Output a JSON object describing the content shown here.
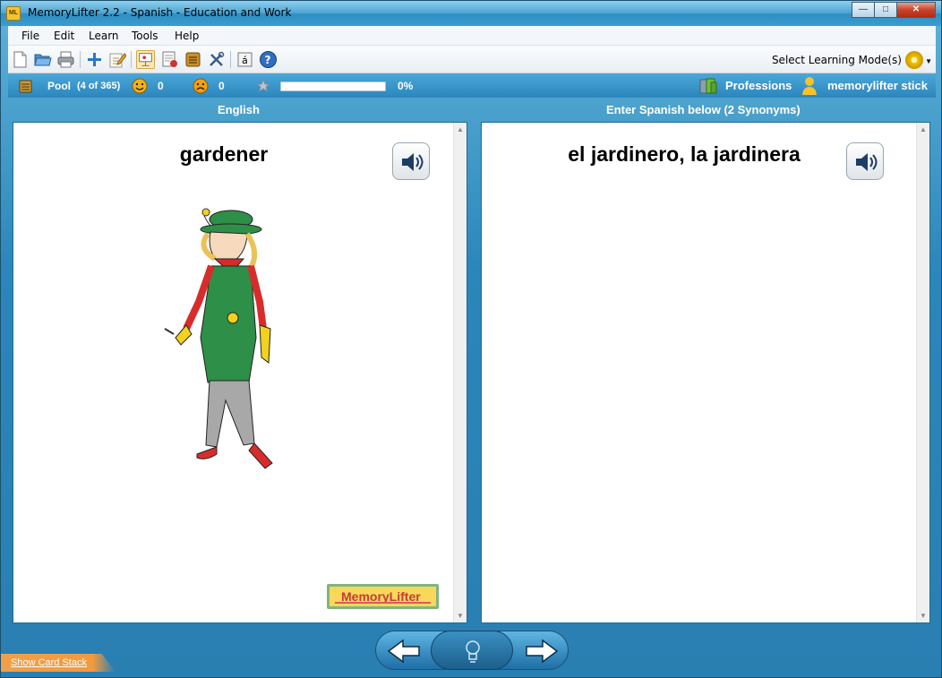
{
  "window": {
    "title": "MemoryLifter 2.2 - Spanish - Education and Work",
    "icon_text": "ML"
  },
  "menu": {
    "items": [
      "File",
      "Edit",
      "Learn",
      "Tools",
      "Help"
    ]
  },
  "toolbar": {
    "icons": [
      "new-file-icon",
      "open-folder-icon",
      "print-icon",
      "add-card-icon",
      "edit-notes-icon",
      "presentation-icon",
      "card-view-icon",
      "chapter-icon",
      "settings-tools-icon",
      "special-char-icon",
      "help-icon"
    ],
    "mode_label": "Select Learning Mode(s)"
  },
  "status": {
    "pool_label": "Pool",
    "pool_count": "(4 of 365)",
    "correct_count": "0",
    "wrong_count": "0",
    "progress_percent": 0,
    "progress_text": "0%",
    "category": "Professions",
    "user": "memorylifter stick"
  },
  "columns": {
    "left_header": "English",
    "right_header": "Enter Spanish below (2 Synonyms)"
  },
  "card": {
    "question": "gardener",
    "answer": "el jardinero, la jardinera",
    "logo_text": "MemoryLifter"
  },
  "footer": {
    "show_card_stack": "Show Card Stack"
  },
  "colors": {
    "accent": "#2b86bd",
    "stack_tab": "#f39a3f"
  }
}
